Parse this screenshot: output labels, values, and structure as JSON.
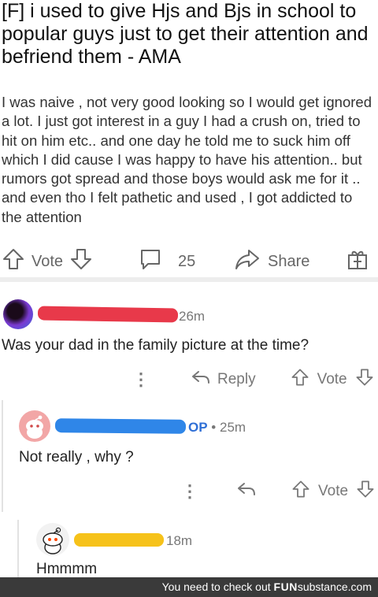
{
  "post": {
    "title": "[F] i used to give Hjs and Bjs in school to popular guys just to get their attention and befriend them - AMA",
    "body": "I was naive , not very good looking so I would get ignored a lot.  I just got interest in a guy I had a crush on, tried to hit on him etc.. and one day he told me to suck him off which I did cause I was happy to have his attention.. but rumors got spread and those boys would ask me for it .. and even tho I felt pathetic and used , I got addicted to the attention",
    "vote_label": "Vote",
    "comment_count": "25",
    "share_label": "Share"
  },
  "comments": [
    {
      "time": "26m",
      "text": "Was your dad in the family picture at the time?",
      "reply_label": "Reply",
      "vote_label": "Vote",
      "redact_color": "#e8394a"
    },
    {
      "op_badge": "OP",
      "time": "25m",
      "text": "Not really , why ?",
      "vote_label": "Vote",
      "redact_color": "#2f86e8"
    },
    {
      "time": "18m",
      "text": "Hmmmm",
      "redact_color": "#f6c21a"
    }
  ],
  "footer": {
    "prefix": "You need to check out",
    "brand": "FUN",
    "brand2": "substance",
    "suffix": ".com"
  }
}
